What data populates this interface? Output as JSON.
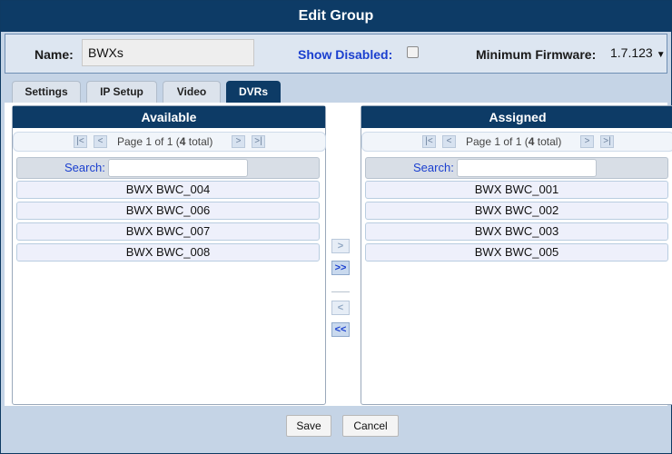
{
  "dialog": {
    "title": "Edit Group"
  },
  "header": {
    "name_label": "Name:",
    "name_value": "BWXs",
    "show_disabled_label": "Show Disabled:",
    "show_disabled_checked": false,
    "min_firmware_label": "Minimum Firmware:",
    "min_firmware_value": "1.7.123"
  },
  "tabs": [
    {
      "label": "Settings",
      "active": false
    },
    {
      "label": "IP Setup",
      "active": false
    },
    {
      "label": "Video",
      "active": false
    },
    {
      "label": "DVRs",
      "active": true
    }
  ],
  "available": {
    "title": "Available",
    "pager_text": "Page 1 of 1 (4 total)",
    "search_label": "Search:",
    "search_value": "",
    "items": [
      "BWX BWC_004",
      "BWX BWC_006",
      "BWX BWC_007",
      "BWX BWC_008"
    ]
  },
  "assigned": {
    "title": "Assigned",
    "pager_text": "Page 1 of 1 (4 total)",
    "search_label": "Search:",
    "search_value": "",
    "items": [
      "BWX BWC_001",
      "BWX BWC_002",
      "BWX BWC_003",
      "BWX BWC_005"
    ]
  },
  "pager_icons": {
    "first": "|<",
    "prev": "<",
    "next": ">",
    "last": ">|"
  },
  "move_buttons": {
    "move_one_right": ">",
    "move_all_right": ">>",
    "move_one_left": "<",
    "move_all_left": "<<"
  },
  "footer": {
    "save_label": "Save",
    "cancel_label": "Cancel"
  },
  "colors": {
    "title_bar": "#0d3b66",
    "dialog_bg": "#c5d4e6",
    "link_blue": "#1a3fcf"
  }
}
